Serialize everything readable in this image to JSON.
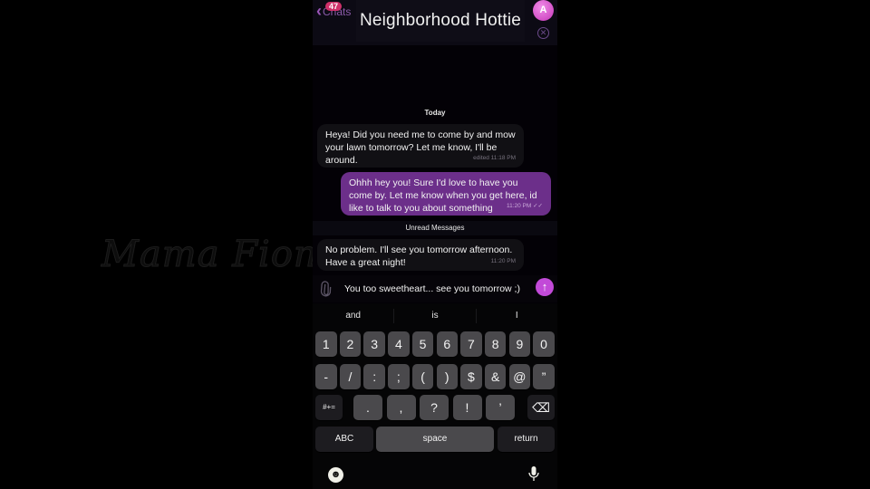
{
  "watermark": "Mama Fiona",
  "header": {
    "back_label": "Chats",
    "unread_badge": "47",
    "title": "Neighborhood Hottie",
    "avatar_initial": "A",
    "accent_color": "#c535b8"
  },
  "conversation": {
    "date_separator": "Today",
    "unread_separator": "Unread Messages",
    "messages": [
      {
        "direction": "incoming",
        "text": "Heya! Did you need me to come by and mow your lawn tomorrow? Let me know, I'll be around.",
        "meta": "edited 11:18 PM"
      },
      {
        "direction": "outgoing",
        "text": "Ohhh hey you! Sure I'd love to have you come by. Let me know when you get here, id like to talk to you about something",
        "meta": "11:20 PM",
        "read_status": "✓✓"
      },
      {
        "direction": "incoming",
        "text": "No problem. I'll see you tomorrow afternoon. Have a great night!",
        "meta": "11:20 PM"
      }
    ]
  },
  "composer": {
    "value": "You too sweetheart... see you tomorrow ;)",
    "send_icon": "arrow-up-icon",
    "attach_icon": "paperclip-icon"
  },
  "keyboard": {
    "suggestions": [
      "and",
      "is",
      "I"
    ],
    "row1": [
      "1",
      "2",
      "3",
      "4",
      "5",
      "6",
      "7",
      "8",
      "9",
      "0"
    ],
    "row2": [
      "-",
      "/",
      ":",
      ";",
      "(",
      ")",
      "$",
      "&",
      "@",
      "”"
    ],
    "row3_left": "#+=",
    "row3": [
      ".",
      ",",
      "?",
      "!",
      "’"
    ],
    "backspace_icon": "⌫",
    "abc_label": "ABC",
    "space_label": "space",
    "return_label": "return",
    "emoji_icon": "☻",
    "mic_icon": "microphone"
  }
}
